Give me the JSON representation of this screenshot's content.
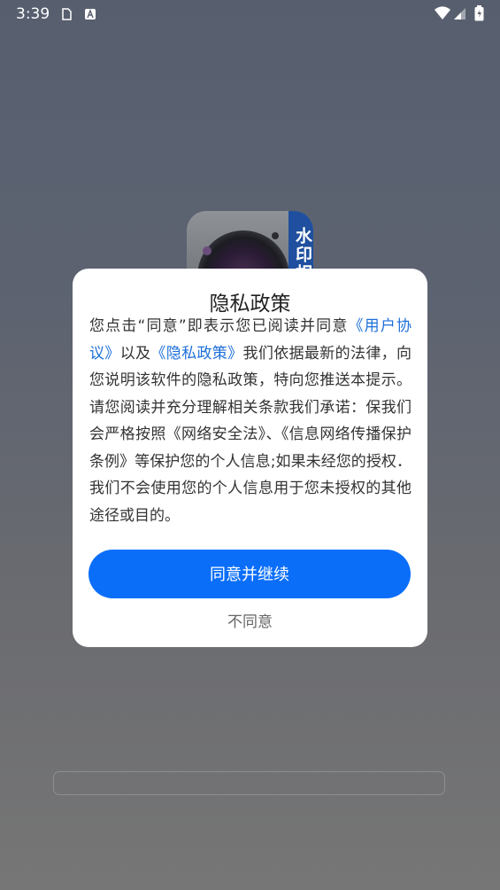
{
  "status_bar": {
    "time": "3:39",
    "icons_left": [
      "storage-icon",
      "a-icon"
    ],
    "icons_right": [
      "wifi-icon",
      "signal-icon",
      "battery-icon"
    ]
  },
  "app_icon": {
    "badge_text": "水印相"
  },
  "dialog": {
    "title": "隐私政策",
    "body_parts": {
      "p1": "您点击“同意”即表示您已阅读并同意",
      "link_user_agreement": "《用户协议》",
      "p2": "以及",
      "link_privacy_policy": "《隐私政策》",
      "p3": "我们依据最新的法律，向您说明该软件的隐私政策，特向您推送本提示。请您阅读并充分理解相关条款我们承诺：保我们会严格按照《网络安全法》、《信息网络传播保护条例》等保护您的个人信息;如果未经您的授权．我们不会使用您的个人信息用于您未授权的其他途径或目的。"
    },
    "agree_label": "同意并继续",
    "disagree_label": "不同意"
  },
  "colors": {
    "primary_button": "#0a6ef9",
    "link": "#1e6fd9",
    "dialog_bg": "#ffffff"
  }
}
